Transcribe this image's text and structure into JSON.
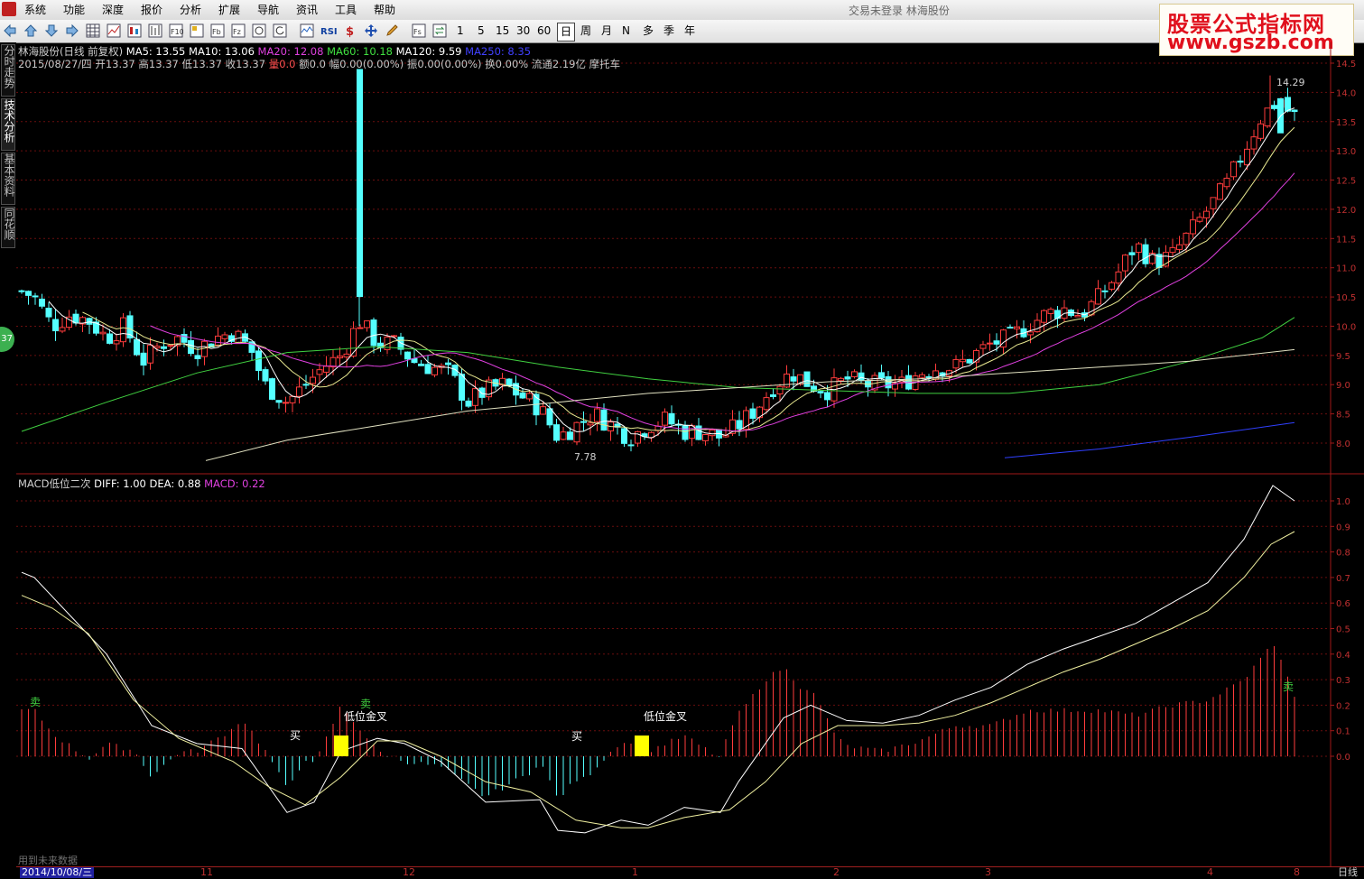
{
  "menubar": {
    "items": [
      "系统",
      "功能",
      "深度",
      "报价",
      "分析",
      "扩展",
      "导航",
      "资讯",
      "工具",
      "帮助"
    ],
    "title": "交易未登录   林海股份"
  },
  "toolbar": {
    "periods": [
      "1",
      "5",
      "15",
      "30",
      "60",
      "日",
      "周",
      "月",
      "N",
      "多",
      "季",
      "年"
    ],
    "active_period": "日",
    "icons": [
      "back-icon",
      "up-icon",
      "down-icon",
      "forward-icon",
      "table-icon",
      "line-chart-icon",
      "candle-icon",
      "f10-icon",
      "f10-alt-icon",
      "f10b-icon",
      "f10c-icon",
      "fnz-icon",
      "refresh-icon",
      "rsi-chart-icon",
      "rsi-icon",
      "dollar-icon",
      "move-icon",
      "pen-icon",
      "fs-icon",
      "sync-icon"
    ]
  },
  "ad": {
    "line1": "股票公式指标网",
    "line2": "www.gszb.com"
  },
  "side_tabs": [
    "分时走势",
    "技术分析",
    "基本资料",
    "同花顺"
  ],
  "badge": "37",
  "main": {
    "ma_legend": [
      {
        "label": "林海股份(日线 前复权)",
        "color": "#d0d0d0"
      },
      {
        "label": "MA5: 13.55",
        "color": "#ffffff"
      },
      {
        "label": "MA10: 13.06",
        "color": "#ffffff"
      },
      {
        "label": "MA20: 12.08",
        "color": "#e040e0"
      },
      {
        "label": "MA60: 10.18",
        "color": "#40e040"
      },
      {
        "label": "MA120: 9.59",
        "color": "#ffffff"
      },
      {
        "label": "MA250: 8.35",
        "color": "#4040ff"
      }
    ],
    "bar_info": [
      {
        "label": "2015/08/27/四",
        "color": "#d0d0d0"
      },
      {
        "label": "开13.37",
        "color": "#d0d0d0"
      },
      {
        "label": "高13.37",
        "color": "#d0d0d0"
      },
      {
        "label": "低13.37",
        "color": "#d0d0d0"
      },
      {
        "label": "收13.37",
        "color": "#d0d0d0"
      },
      {
        "label": "量0.0",
        "color": "#ff5050"
      },
      {
        "label": "额0.0",
        "color": "#d0d0d0"
      },
      {
        "label": "幅0.00(0.00%)",
        "color": "#d0d0d0"
      },
      {
        "label": "振0.00(0.00%)",
        "color": "#d0d0d0"
      },
      {
        "label": "换0.00%",
        "color": "#d0d0d0"
      },
      {
        "label": "流通2.19亿",
        "color": "#d0d0d0"
      },
      {
        "label": "摩托车",
        "color": "#d0d0d0"
      }
    ],
    "high_label": "14.29",
    "low_label": "7.78",
    "y_ticks": [
      "14.5",
      "14.0",
      "13.5",
      "13.0",
      "12.5",
      "12.0",
      "11.5",
      "11.0",
      "10.5",
      "10.0",
      "9.5",
      "9.0",
      "8.5",
      "8.0"
    ]
  },
  "macd": {
    "legend": [
      {
        "label": "MACD低位二次",
        "color": "#d0d0d0"
      },
      {
        "label": "DIFF: 1.00",
        "color": "#ffffff"
      },
      {
        "label": "DEA: 0.88",
        "color": "#ffffff"
      },
      {
        "label": "MACD: 0.22",
        "color": "#e040e0"
      }
    ],
    "y_ticks": [
      "1.0",
      "0.9",
      "0.8",
      "0.7",
      "0.6",
      "0.5",
      "0.4",
      "0.3",
      "0.2",
      "0.1",
      "0.0"
    ],
    "annotations": {
      "sell1": "卖",
      "buy1": "买",
      "cross1": "低位金叉",
      "sell2": "卖",
      "buy2": "买",
      "cross2": "低位金叉",
      "sell3": "卖"
    }
  },
  "footer": {
    "note": "用到未来数据",
    "date": "2014/10/08/三",
    "months": [
      "11",
      "12",
      "1",
      "2",
      "3",
      "4",
      "8"
    ],
    "period_label": "日线"
  },
  "colors": {
    "up": "#ff3c3c",
    "down": "#54ffff",
    "grid": "#7a1010",
    "axis_text": "#c03030"
  }
}
